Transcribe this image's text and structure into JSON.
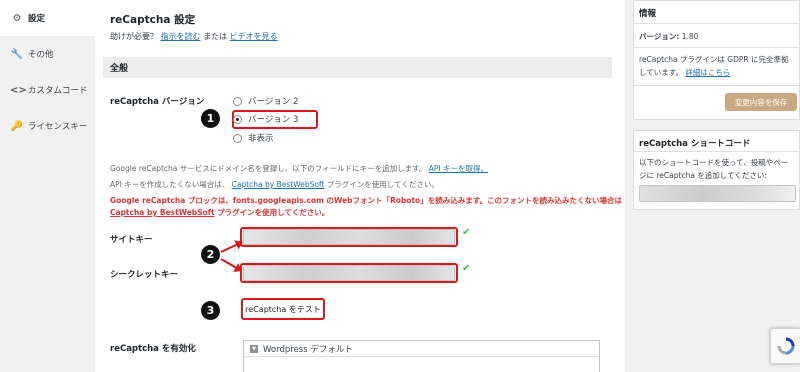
{
  "nav": {
    "items": [
      {
        "icon": "gear-icon",
        "label": "設定",
        "active": true
      },
      {
        "icon": "wrench-icon",
        "label": "その他",
        "active": false
      },
      {
        "icon": "code-icon",
        "label": "カスタムコード",
        "active": false
      },
      {
        "icon": "key-icon",
        "label": "ライセンスキー",
        "active": false
      }
    ]
  },
  "header": {
    "title": "reCaptcha 設定",
    "help_prefix": "助けが必要？",
    "help_read": "指示を読む",
    "help_or": "または",
    "help_video": "ビデオを見る"
  },
  "section": {
    "title": "全般"
  },
  "version": {
    "label": "reCaptcha バージョン",
    "options": [
      "バージョン 2",
      "バージョン 3",
      "非表示"
    ],
    "selected": "バージョン 3"
  },
  "info": {
    "line1_text": "Google reCaptcha サービスにドメイン名を登録し、以下のフィールドにキーを追加します。",
    "line1_link": "API キーを取得。",
    "line2_text": "API キーを作成したくない場合は、",
    "line2_link": "Captcha by BestWebSoft",
    "line2_suffix": "プラグインを使用してください。",
    "warn1": "Google reCaptcha ブロックは、fonts.googleapis.com のWebフォント「Roboto」を読み込みます。このフォントを読み込みたくない場合は",
    "warn2_link": "Captcha by BestWebSoft",
    "warn2_suffix": "プラグインを使用してください。"
  },
  "keys": {
    "site_label": "サイトキー",
    "secret_label": "シークレットキー"
  },
  "annotations": {
    "step1": "1",
    "step2": "2",
    "step3": "3"
  },
  "test_button": "reCaptcha をテスト",
  "enable": {
    "label": "reCaptcha を有効化",
    "selected": "Wordpress デフォルト"
  },
  "sidebar": {
    "info_title": "情報",
    "version_label": "バージョン:",
    "version_value": "1.80",
    "gdpr_text": "reCaptcha プラグインは GDPR に完全準拠しています。",
    "gdpr_link": "詳細はこちら",
    "save_button": "変更内容を保存",
    "shortcode_title": "reCaptcha ショートコード",
    "shortcode_desc": "以下のショートコードを使って、投稿やページに reCaptcha を追加してください:"
  },
  "colors": {
    "annotation_red": "#d9191b",
    "link_blue": "#2271b1",
    "warning_red": "#d63638",
    "save_button": "#caa982",
    "check_green": "#46b450"
  }
}
